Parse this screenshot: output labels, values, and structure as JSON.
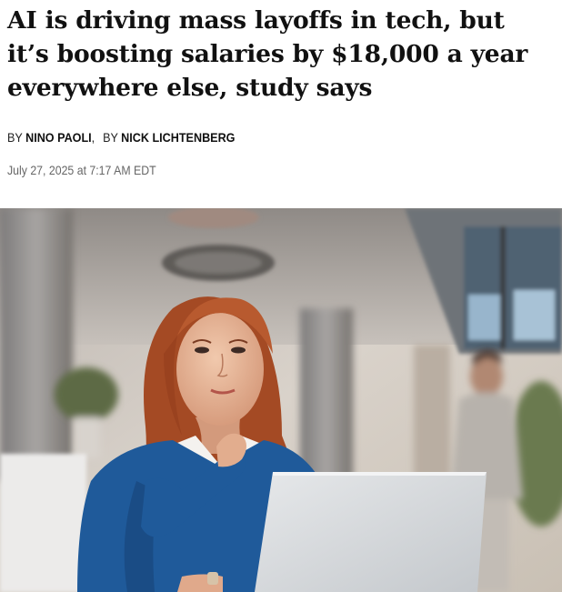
{
  "article": {
    "headline": "AI is driving mass layoffs in tech, but it’s boosting salaries by $18,000 a year everywhere else, study says",
    "byline": {
      "prefix": "BY",
      "authors": [
        "NINO PAOLI",
        "NICK LICHTENBERG"
      ],
      "separator": ","
    },
    "timestamp": "July 27, 2025 at 7:17 AM EDT",
    "hero_image": {
      "subject": "photo-woman-at-laptop-office",
      "colors": {
        "sweater": "#1f5a9a",
        "hair": "#b4532a",
        "laptop": "#d9dde1",
        "background": "#cfc8c0"
      }
    }
  }
}
